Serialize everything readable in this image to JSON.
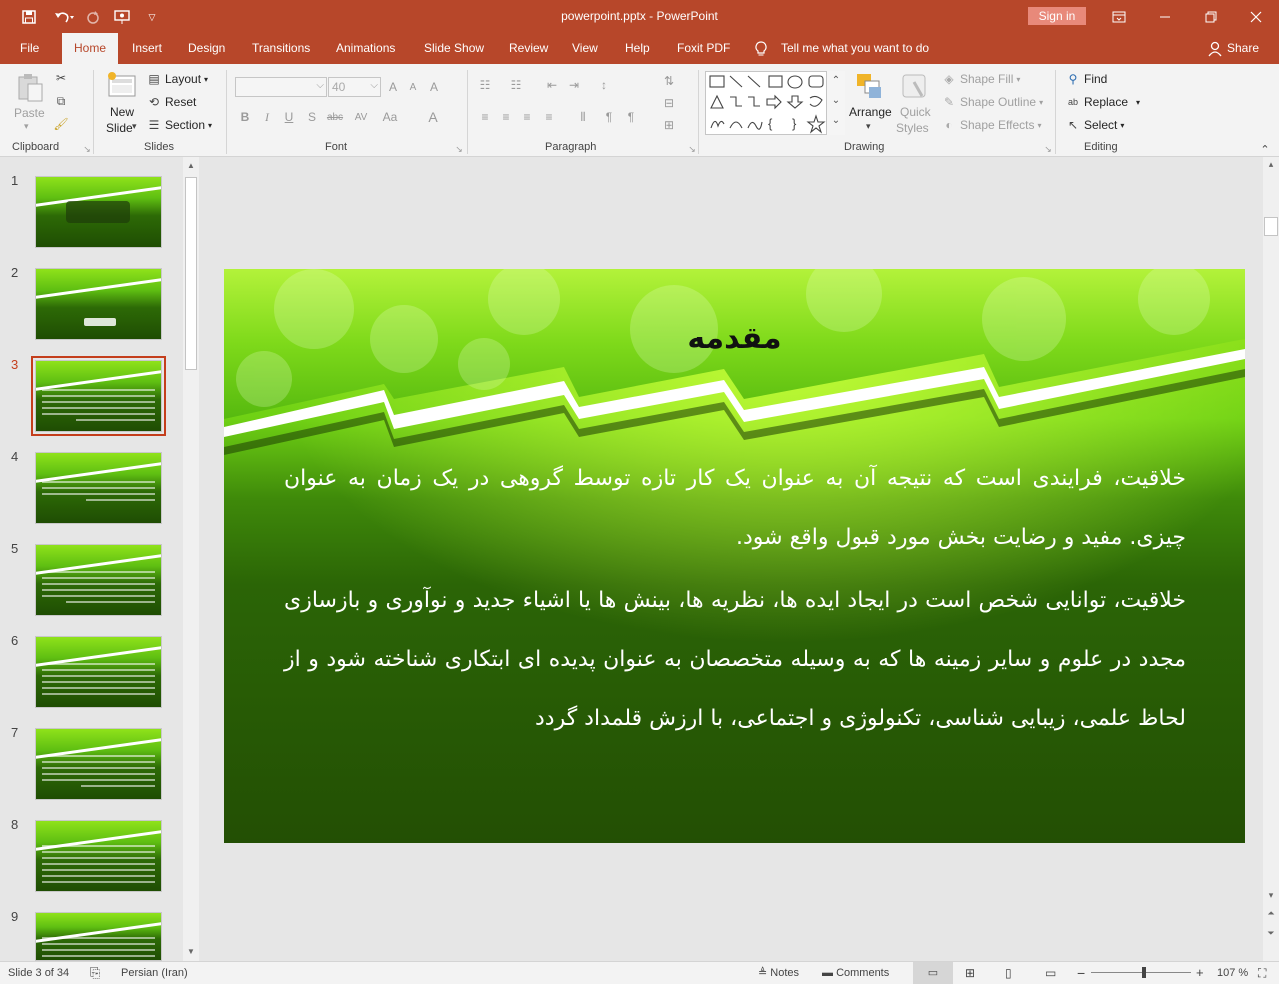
{
  "window": {
    "title": "powerpoint.pptx  -  PowerPoint",
    "sign_in": "Sign in"
  },
  "qat": {
    "icons": [
      "save-icon",
      "undo-icon",
      "redo-icon",
      "present-icon",
      "customize-icon"
    ]
  },
  "tabs": [
    "File",
    "Home",
    "Insert",
    "Design",
    "Transitions",
    "Animations",
    "Slide Show",
    "Review",
    "View",
    "Help",
    "Foxit PDF"
  ],
  "active_tab": "Home",
  "tell_me": "Tell me what you want to do",
  "share": "Share",
  "ribbon": {
    "clipboard": {
      "paste": "Paste",
      "label": "Clipboard"
    },
    "slides": {
      "new_slide_1": "New",
      "new_slide_2": "Slide",
      "layout": "Layout",
      "reset": "Reset",
      "section": "Section",
      "label": "Slides"
    },
    "font": {
      "font_name": "",
      "font_size": "40",
      "bold": "B",
      "italic": "I",
      "underline": "U",
      "shadow": "S",
      "strike": "abc",
      "spacing": "AV",
      "case": "Aa",
      "color": "A",
      "label": "Font"
    },
    "paragraph": {
      "label": "Paragraph"
    },
    "drawing": {
      "arrange": "Arrange",
      "quick_1": "Quick",
      "quick_2": "Styles",
      "shape_fill": "Shape Fill",
      "shape_outline": "Shape Outline",
      "shape_effects": "Shape Effects",
      "label": "Drawing"
    },
    "editing": {
      "find": "Find",
      "replace": "Replace",
      "select": "Select",
      "label": "Editing"
    }
  },
  "thumbnails": [
    {
      "num": "1",
      "selected": false
    },
    {
      "num": "2",
      "selected": false
    },
    {
      "num": "3",
      "selected": true
    },
    {
      "num": "4",
      "selected": false
    },
    {
      "num": "5",
      "selected": false
    },
    {
      "num": "6",
      "selected": false
    },
    {
      "num": "7",
      "selected": false
    },
    {
      "num": "8",
      "selected": false
    },
    {
      "num": "9",
      "selected": false
    }
  ],
  "slide": {
    "title": "مقدمه",
    "paragraph_1": "خلاقیت، فرایندی است که نتیجه آن به عنوان یک کار تازه توسط گروهی در یک زمان به عنوان چیزی. مفید و رضایت بخش مورد قبول واقع شود.",
    "paragraph_2": "خلاقیت، توانایی شخص است در ایجاد ایده ها، نظریه ها، بینش ها یا اشیاء جدید و نوآوری و بازسازی مجدد در علوم و سایر زمینه ها که به وسیله متخصصان به عنوان پدیده ای ابتکاری شناخته شود و از لحاظ علمی، زیبایی شناسی، تکنولوژی و اجتماعی، با ارزش قلمداد گردد"
  },
  "status": {
    "slide_info": "Slide 3 of 34",
    "language": "Persian (Iran)",
    "notes": "Notes",
    "comments": "Comments",
    "zoom": "107 %",
    "zoom_level": 0.53
  },
  "colors": {
    "accent": "#b7472a",
    "selection": "#c43e1c",
    "slide_dark": "#234f04",
    "slide_light": "#9ae81c"
  }
}
